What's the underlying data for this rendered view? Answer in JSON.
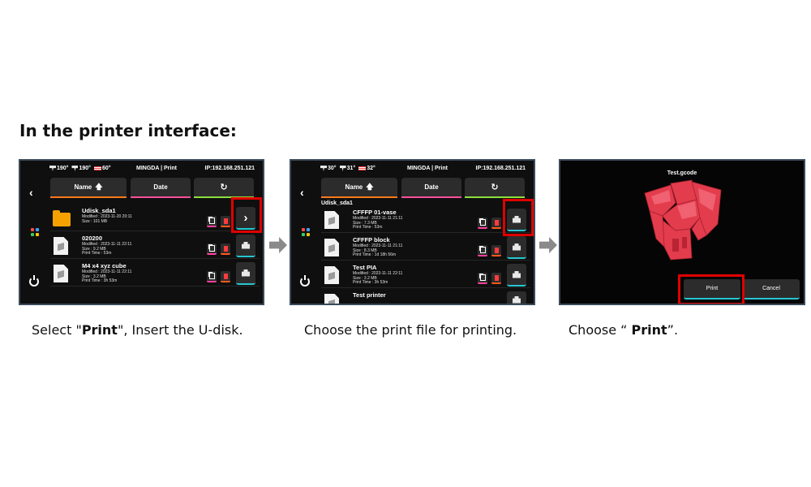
{
  "heading": "In the printer interface:",
  "screens": [
    {
      "status": {
        "nozzle1": "190°",
        "nozzle2": "190°",
        "bed": "60°",
        "title": "MINGDA | Print",
        "ip": "IP:192.168.251.121"
      },
      "tabs": {
        "name": "Name",
        "date": "Date"
      },
      "path": "",
      "files": [
        {
          "name": "Udisk_sda1",
          "type": "folder",
          "meta": [
            "Modified : 2023-11-20 20:11",
            "Size : 101 MB"
          ],
          "action": "open"
        },
        {
          "name": "020200",
          "type": "file",
          "meta": [
            "Modified : 2023-11-11 22:11",
            "Size : 9.2 MB",
            "Print Time : 53m"
          ],
          "action": "print"
        },
        {
          "name": "M4 x4 xyz cube",
          "type": "file",
          "meta": [
            "Modified : 2023-11-11 22:11",
            "Size : 3.2 MB",
            "Print Time : 3h 53m"
          ],
          "action": "print"
        }
      ]
    },
    {
      "status": {
        "nozzle1": "30°",
        "nozzle2": "31°",
        "bed": "32°",
        "title": "MINGDA | Print",
        "ip": "IP:192.168.251.121"
      },
      "tabs": {
        "name": "Name",
        "date": "Date"
      },
      "path": "Udisk_sda1",
      "files": [
        {
          "name": "CFFFP 01-vase",
          "type": "file",
          "meta": [
            "Modified : 2023-11-11 21:11",
            "Size : 7.3 MB",
            "Print Time : 53m"
          ],
          "action": "print"
        },
        {
          "name": "CFFFP block",
          "type": "file",
          "meta": [
            "Modified : 2023-11-11 21:11",
            "Size : 8.3 MB",
            "Print Time : 1d 18h 56m"
          ],
          "action": "print"
        },
        {
          "name": "Test PIA",
          "type": "file",
          "meta": [
            "Modified : 2023-11-11 22:11",
            "Size : 3.2 MB",
            "Print Time : 3h 53m"
          ],
          "action": "print"
        },
        {
          "name": "Test printer",
          "type": "file",
          "meta": [],
          "action": "print"
        }
      ]
    },
    {
      "file_title": "Test.gcode",
      "print_label": "Print",
      "cancel_label": "Cancel"
    }
  ],
  "captions": [
    {
      "before": "Select \"",
      "bold": "Print",
      "after": "\", Insert the U-disk."
    },
    {
      "before": "Choose the print file for printing.",
      "bold": "",
      "after": ""
    },
    {
      "before": "Choose “ ",
      "bold": "Print",
      "after": "”."
    }
  ],
  "colors": {
    "highlight": "#e00000",
    "name_tab_accent": "#ff7a1a",
    "date_tab_accent": "#ff4f9d",
    "refresh_tab_accent": "#8de03d",
    "action_accent": "#27c7d1",
    "model": "#e8404e"
  },
  "icons": [
    "thermometer-icon",
    "bed-icon",
    "back-icon",
    "apps-icon",
    "power-icon",
    "sort-up-icon",
    "refresh-icon",
    "folder-icon",
    "gcode-file-icon",
    "copy-icon",
    "delete-icon",
    "print-icon",
    "chevron-right-icon",
    "flow-arrow-icon"
  ]
}
